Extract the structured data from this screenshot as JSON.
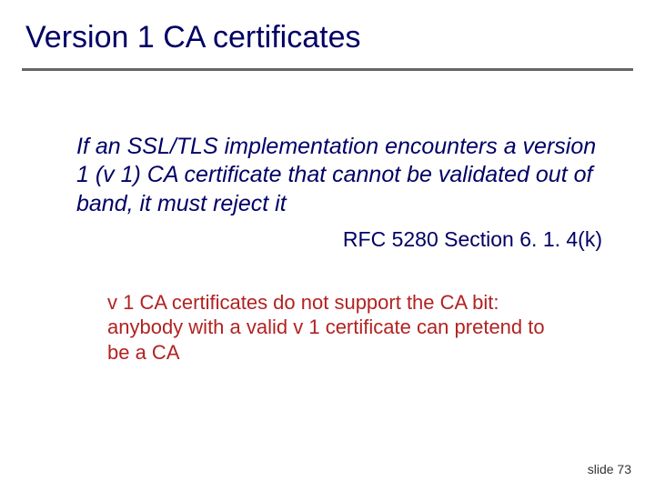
{
  "title": "Version 1 CA certificates",
  "quote": "If an SSL/TLS implementation encounters a version 1 (v 1) CA certificate that cannot be validated out of band, it must reject it",
  "citation": "RFC 5280 Section 6. 1. 4(k)",
  "note": "v 1 CA certificates do not support the CA bit: anybody with a valid v 1 certificate can pretend to be a CA",
  "footer": "slide 73"
}
